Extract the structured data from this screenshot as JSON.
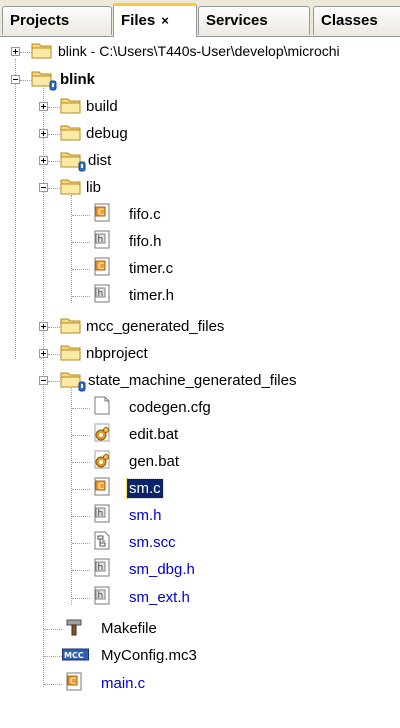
{
  "tabs": [
    {
      "label": "Projects"
    },
    {
      "label": "Files",
      "close": "×"
    },
    {
      "label": "Services"
    },
    {
      "label": "Classes"
    }
  ],
  "tree": {
    "root_path": "blink - C:\\Users\\T440s-User\\develop\\microchi",
    "project": "blink",
    "items": [
      {
        "label": "build"
      },
      {
        "label": "debug"
      },
      {
        "label": "dist"
      },
      {
        "label": "lib"
      },
      {
        "label": "fifo.c"
      },
      {
        "label": "fifo.h"
      },
      {
        "label": "timer.c"
      },
      {
        "label": "timer.h"
      },
      {
        "label": "mcc_generated_files"
      },
      {
        "label": "nbproject"
      },
      {
        "label": "state_machine_generated_files"
      },
      {
        "label": "codegen.cfg"
      },
      {
        "label": "edit.bat"
      },
      {
        "label": "gen.bat"
      },
      {
        "label": "sm.c"
      },
      {
        "label": "sm.h"
      },
      {
        "label": "sm.scc"
      },
      {
        "label": "sm_dbg.h"
      },
      {
        "label": "sm_ext.h"
      },
      {
        "label": "Makefile"
      },
      {
        "label": "MyConfig.mc3"
      },
      {
        "label": "main.c"
      }
    ]
  },
  "icons": {
    "folder": "folder-icon",
    "c_file": "c-source-icon",
    "h_file": "header-file-icon",
    "text_file": "text-file-icon",
    "bat_file": "gear-script-icon",
    "scc_file": "state-chart-icon",
    "makefile": "makefile-icon",
    "mc3_file": "mcc-config-icon"
  },
  "colors": {
    "tab_active_accent": "#ffc83c",
    "modified_text": "#0000d0",
    "selection": "#0a246a",
    "folder_fill": "#f5d77c"
  }
}
